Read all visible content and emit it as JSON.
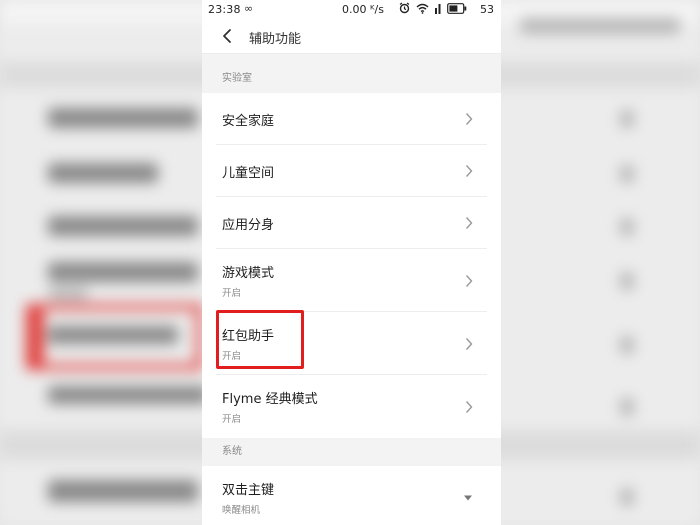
{
  "status_bar": {
    "time": "23:38",
    "loop_glyph": "∞",
    "net_speed": "0.00 ᴷ/s",
    "battery_level": "53"
  },
  "header": {
    "title": "辅助功能"
  },
  "sections": [
    {
      "header": "实验室",
      "items": [
        {
          "label": "安全家庭",
          "sub": ""
        },
        {
          "label": "儿童空间",
          "sub": ""
        },
        {
          "label": "应用分身",
          "sub": ""
        },
        {
          "label": "游戏模式",
          "sub": "开启"
        },
        {
          "label": "红包助手",
          "sub": "开启"
        },
        {
          "label": "Flyme 经典模式",
          "sub": "开启"
        }
      ]
    },
    {
      "header": "系统",
      "items": [
        {
          "label": "双击主键",
          "sub": "唤醒相机"
        }
      ]
    }
  ],
  "colors": {
    "highlight_box": "#e11d1d",
    "background": "#f3f3f3",
    "list_background": "#ffffff"
  },
  "icons": [
    "back-arrow-icon",
    "chevron-right-icon",
    "caret-down-icon",
    "wifi-icon",
    "alarm-icon",
    "battery-icon",
    "signal-icon"
  ]
}
